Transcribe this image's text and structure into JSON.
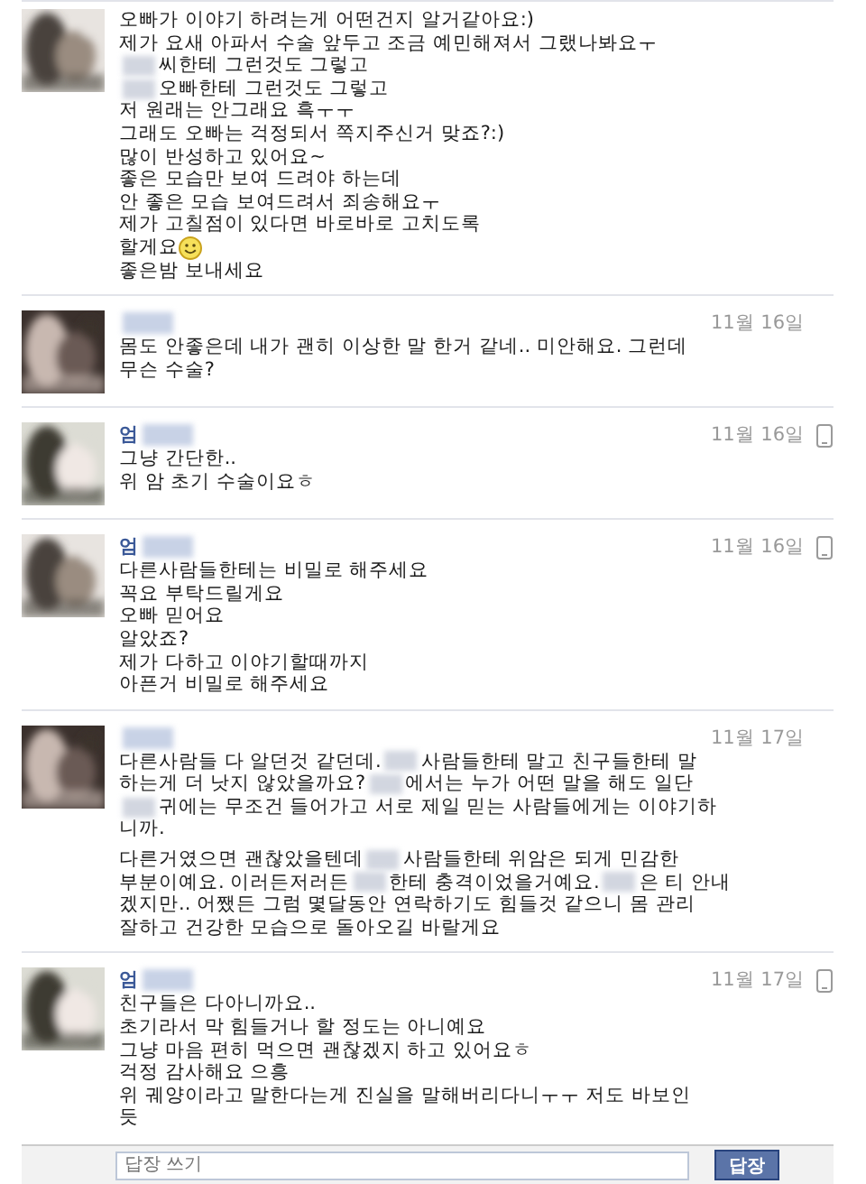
{
  "messages": [
    {
      "avatar": {
        "kind": "picture"
      },
      "paragraphs": [
        [
          [
            {
              "kind": "text",
              "text": "오빠가 이야기 하려는게 어떤건지 알거같아요:)"
            }
          ],
          [
            {
              "kind": "text",
              "text": "제가 요새 아파서 수술 앞두고 조금 예민해져서 그랬나봐요ㅜ"
            }
          ],
          [
            {
              "kind": "redacted"
            },
            {
              "kind": "text",
              "text": "씨한테 그런것도 그렇고"
            }
          ],
          [
            {
              "kind": "redacted"
            },
            {
              "kind": "text",
              "text": "오빠한테 그런것도 그렇고"
            }
          ],
          [
            {
              "kind": "text",
              "text": "저 원래는 안그래요 흑ㅜㅜ"
            }
          ],
          [
            {
              "kind": "text",
              "text": "그래도 오빠는 걱정되서 쪽지주신거 맞죠?:)"
            }
          ],
          [
            {
              "kind": "text",
              "text": "많이 반성하고 있어요~"
            }
          ],
          [
            {
              "kind": "text",
              "text": "좋은 모습만 보여 드려야 하는데"
            }
          ],
          [
            {
              "kind": "text",
              "text": "안 좋은 모습 보여드려서 죄송해요ㅜ"
            }
          ],
          [
            {
              "kind": "text",
              "text": "제가 고칠점이 있다면 바로바로 고치도록"
            }
          ],
          [
            {
              "kind": "text",
              "text": "할게요 "
            },
            {
              "kind": "emoticon"
            }
          ],
          [
            {
              "kind": "text",
              "text": "좋은밤 보내세요"
            }
          ]
        ]
      ]
    },
    {
      "avatar": {
        "kind": "picture"
      },
      "sender": [
        {
          "kind": "redacted"
        }
      ],
      "date": "11월 16일",
      "mobile": false,
      "paragraphs": [
        [
          [
            {
              "kind": "text",
              "text": "몸도 안좋은데 내가 괜히 이상한 말 한거 같네.. 미안해요. 그런데"
            }
          ],
          [
            {
              "kind": "text",
              "text": "무슨 수술?"
            }
          ]
        ]
      ]
    },
    {
      "avatar": {
        "kind": "picture"
      },
      "sender": [
        {
          "kind": "text",
          "text": "엄"
        },
        {
          "kind": "redacted"
        }
      ],
      "date": "11월 16일",
      "mobile": true,
      "paragraphs": [
        [
          [
            {
              "kind": "text",
              "text": "그냥 간단한.."
            }
          ],
          [
            {
              "kind": "text",
              "text": "위 암 초기 수술이요ㅎ"
            }
          ]
        ]
      ]
    },
    {
      "avatar": {
        "kind": "picture"
      },
      "sender": [
        {
          "kind": "text",
          "text": "엄"
        },
        {
          "kind": "redacted"
        }
      ],
      "date": "11월 16일",
      "mobile": true,
      "paragraphs": [
        [
          [
            {
              "kind": "text",
              "text": "다른사람들한테는 비밀로 해주세요"
            }
          ],
          [
            {
              "kind": "text",
              "text": "꼭요 부탁드릴게요"
            }
          ],
          [
            {
              "kind": "text",
              "text": "오빠 믿어요"
            }
          ],
          [
            {
              "kind": "text",
              "text": "알았죠?"
            }
          ],
          [
            {
              "kind": "text",
              "text": "제가 다하고 이야기할때까지"
            }
          ],
          [
            {
              "kind": "text",
              "text": "아픈거 비밀로 해주세요"
            }
          ]
        ]
      ]
    },
    {
      "avatar": {
        "kind": "picture"
      },
      "sender": [
        {
          "kind": "redacted"
        }
      ],
      "date": "11월 17일",
      "mobile": false,
      "paragraphs": [
        [
          [
            {
              "kind": "text",
              "text": "다른사람들 다 알던것 같던데. "
            },
            {
              "kind": "redacted"
            },
            {
              "kind": "text",
              "text": " 사람들한테 말고 친구들한테 말"
            }
          ],
          [
            {
              "kind": "text",
              "text": "하는게 더 낫지 않았을까요? "
            },
            {
              "kind": "redacted"
            },
            {
              "kind": "text",
              "text": " 에서는 누가 어떤 말을 해도 일단"
            }
          ],
          [
            {
              "kind": "redacted"
            },
            {
              "kind": "text",
              "text": " 귀에는 무조건 들어가고 서로 제일 믿는 사람들에게는 이야기하"
            }
          ],
          [
            {
              "kind": "text",
              "text": "니까."
            }
          ]
        ],
        [
          [
            {
              "kind": "text",
              "text": "다른거였으면 괜찮았을텐데 "
            },
            {
              "kind": "redacted"
            },
            {
              "kind": "text",
              "text": " 사람들한테 위암은 되게 민감한"
            }
          ],
          [
            {
              "kind": "text",
              "text": "부분이예요. 이러든저러든 "
            },
            {
              "kind": "redacted"
            },
            {
              "kind": "text",
              "text": "한테 충격이었을거예요. "
            },
            {
              "kind": "redacted"
            },
            {
              "kind": "text",
              "text": "은 티 안내"
            }
          ],
          [
            {
              "kind": "text",
              "text": "겠지만.. 어쨌든 그럼 몇달동안 연락하기도 힘들것 같으니 몸 관리"
            }
          ],
          [
            {
              "kind": "text",
              "text": "잘하고 건강한 모습으로 돌아오길 바랄게요"
            }
          ]
        ]
      ]
    },
    {
      "avatar": {
        "kind": "picture"
      },
      "sender": [
        {
          "kind": "text",
          "text": "엄"
        },
        {
          "kind": "redacted"
        }
      ],
      "date": "11월 17일",
      "mobile": true,
      "paragraphs": [
        [
          [
            {
              "kind": "text",
              "text": "친구들은 다아니까요.."
            }
          ],
          [
            {
              "kind": "text",
              "text": "초기라서 막 힘들거나 할 정도는 아니예요"
            }
          ],
          [
            {
              "kind": "text",
              "text": "그냥 마음 편히 먹으면 괜찮겠지 하고 있어요ㅎ"
            }
          ],
          [
            {
              "kind": "text",
              "text": "걱정 감사해요 으흥"
            }
          ],
          [
            {
              "kind": "text",
              "text": "위 궤양이라고 말한다는게 진실을 말해버리다니ㅜㅜ 저도 바보인"
            }
          ],
          [
            {
              "kind": "text",
              "text": "듯"
            }
          ]
        ]
      ]
    }
  ],
  "reply": {
    "placeholder": "답장 쓰기",
    "button": "답장"
  }
}
